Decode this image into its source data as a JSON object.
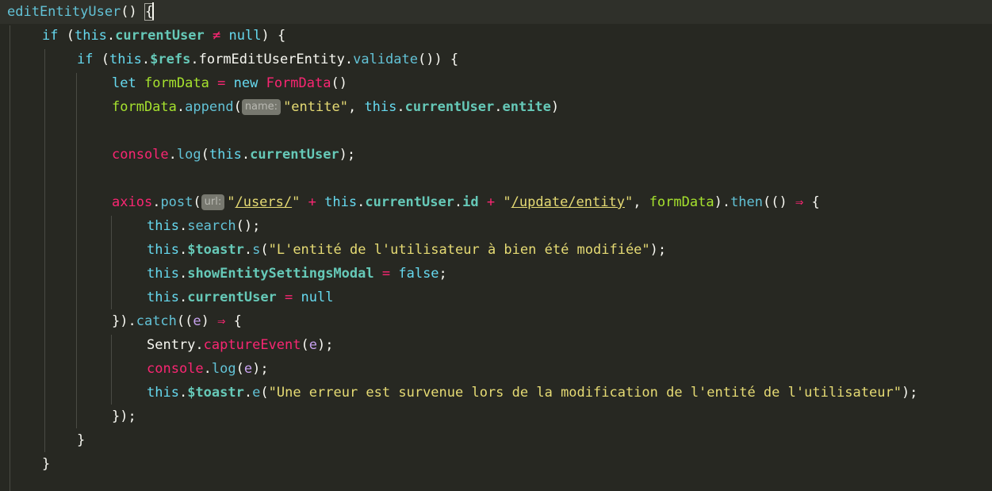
{
  "code": {
    "fn_name": "editEntityUser",
    "open_sig": "() ",
    "open_brace": "{",
    "kw_if": "if",
    "kw_let": "let",
    "kw_new": "new",
    "kw_this": "this",
    "lit_null": "null",
    "lit_false": "false",
    "prop_currentUser": "currentUser",
    "prop_refs": "$refs",
    "prop_toastr": "$toastr",
    "prop_showEntitySettingsModal": "showEntitySettingsModal",
    "prop_entite": "entite",
    "prop_id": "id",
    "ref_form": "formEditUserEntity",
    "m_validate": "validate",
    "m_append": "append",
    "m_log": "log",
    "m_post": "post",
    "m_then": "then",
    "m_search": "search",
    "m_s": "s",
    "m_catch": "catch",
    "m_captureEvent": "captureEvent",
    "m_e": "e",
    "var_formData": "formData",
    "class_FormData": "FormData",
    "id_console": "console",
    "id_axios": "axios",
    "id_Sentry": "Sentry",
    "param_e": "e",
    "op_neq": "≠",
    "op_assign": "=",
    "op_plus": "+",
    "op_arrow": "⇒",
    "hint_name": "name:",
    "hint_url": "url:",
    "str_entite": "\"entite\"",
    "str_users_q1": "\"",
    "str_users": "/users/",
    "str_users_q2": "\"",
    "str_update_q1": "\"",
    "str_update": "/update/entity",
    "str_update_q2": "\"",
    "str_success": "\"L'entité de l'utilisateur à bien été modifiée\"",
    "str_error": "\"Une erreur est survenue lors de la modification de l'entité de l'utilisateur\""
  },
  "theme": {
    "background": "#272822",
    "current_line": "#2f302a",
    "keyword": "#66d9ef",
    "string": "#e6db74",
    "operator": "#f92672",
    "variable": "#a6e22e",
    "property": "#66c9b8",
    "parameter": "#c8a2f0",
    "hint_bg": "#77786f"
  }
}
